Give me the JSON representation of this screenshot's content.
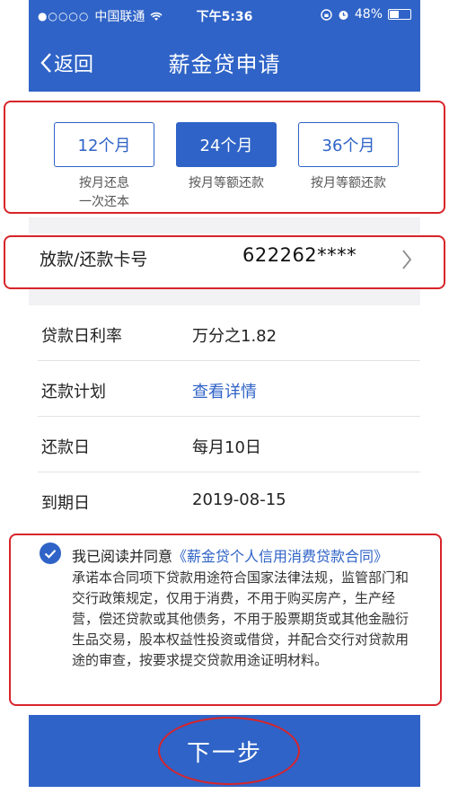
{
  "status_bar": {
    "carrier": "中国联通",
    "time": "下午5:36",
    "battery": "48%",
    "battery_level": 0.48
  },
  "nav": {
    "back_label": "返回",
    "title": "薪金贷申请"
  },
  "terms": [
    {
      "label": "12个月",
      "desc": "按月还息\n一次还本",
      "selected": false
    },
    {
      "label": "24个月",
      "desc": "按月等额还款",
      "selected": true
    },
    {
      "label": "36个月",
      "desc": "按月等额还款",
      "selected": false
    }
  ],
  "card": {
    "label": "放款/还款卡号",
    "value": "622262****"
  },
  "details": [
    {
      "label": "贷款日利率",
      "value": "万分之1.82"
    },
    {
      "label": "还款计划",
      "value": "查看详情"
    },
    {
      "label": "还款日",
      "value": "每月10日"
    },
    {
      "label": "到期日",
      "value": "2019-08-15"
    }
  ],
  "agreement": {
    "prefix": "我已阅读并同意",
    "link": "《薪金贷个人信用消费贷款合同》",
    "body": "承诺本合同项下贷款用途符合国家法律法规，监管部门和交行政策规定，仅用于消费，不用于购买房产，生产经营，偿还贷款或其他债务，不用于股票期货或其他金融衍生品交易，股本权益性投资或借贷，并配合交行对贷款用途的审查，按要求提交贷款用途证明材料。"
  },
  "next_button": "下一步",
  "colors": {
    "primary": "#2f63c7",
    "annotation": "#d8242a"
  }
}
